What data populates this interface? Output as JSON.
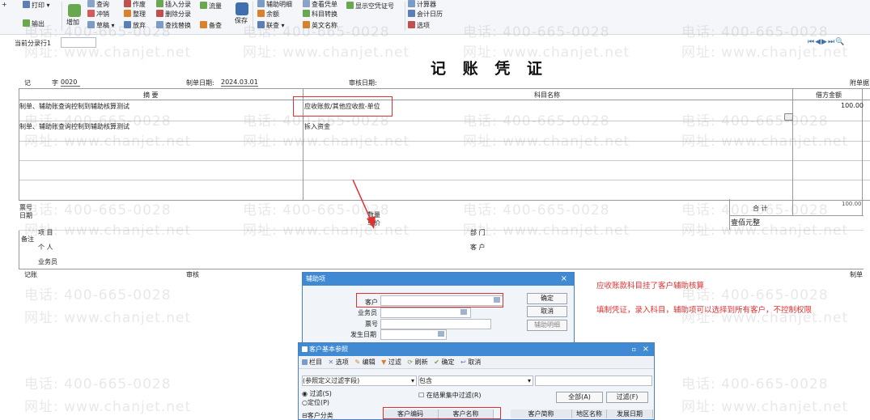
{
  "toolbar": {
    "print": "打印",
    "output": "输出",
    "add": "增加",
    "flush": "冲销",
    "draft": "草稿",
    "tidy": "整理",
    "abandon": "放弃",
    "batch_delete": "删除分录",
    "find_replace": "查找替换",
    "flow": "流量",
    "reference": "备查",
    "save": "保存",
    "balance": "余额",
    "linked_query": "联查",
    "subject_convert": "科目转换",
    "english_name": "英文名称",
    "show_empty_voucher": "显示空凭证号",
    "calculator": "计算器",
    "accounting_calendar": "会计日历",
    "options": "选项"
  },
  "current_entry_label": "当前分录行1",
  "voucher": {
    "title": "记 账 凭 证",
    "type_char": "记",
    "zi": "字",
    "number": "0020",
    "made_date_label": "制单日期:",
    "made_date": "2024.03.01",
    "audit_date_label": "审核日期:",
    "attach_label": "附单据",
    "col_summary": "摘 要",
    "col_subject": "科目名称",
    "col_debit": "借方金额",
    "rows": [
      {
        "summary": "制单、辅助账查询控制到辅助核算测试",
        "subject": "应收账款/其他应收款-单位",
        "debit": "100.00"
      },
      {
        "summary": "制单、辅助账查询控制到辅助核算测试",
        "subject": "拆入资金",
        "debit": ""
      }
    ],
    "ticket_no_label": "票号",
    "date_label": "日期",
    "qty_label": "数量",
    "price_label": "单价",
    "total_label": "合 计",
    "total_amount": "100.00",
    "total_words": "壹佰元整",
    "remark_label": "备注",
    "project_label": "项 目",
    "person_label": "个 人",
    "salesman_label": "业务员",
    "dept_label": "部 门",
    "customer_label": "客 户",
    "bookkeeper_label": "记账",
    "auditor_label": "审核",
    "maker_label": "制单"
  },
  "aux_dialog": {
    "title": "辅助项",
    "customer": "客户",
    "salesman": "业务员",
    "ticket": "票号",
    "date": "发生日期",
    "ok": "确定",
    "cancel": "取消",
    "aux_detail": "辅助明细"
  },
  "customer_ref": {
    "title": "客户基本参照",
    "toolbar": [
      "栏目",
      "选项",
      "编辑",
      "过滤",
      "刷新",
      "确定",
      "取消"
    ],
    "filter_field": "(参照定义过滤字段)",
    "contains": "包含",
    "radio_filter": "过滤(S)",
    "radio_locate": "定位(P)",
    "in_result_filter": "在结果集中过滤(R)",
    "all_btn": "全部(A)",
    "filter_btn": "过滤(F)",
    "tree_root": "客户分类",
    "columns": [
      "客户编码",
      "客户名称",
      "客户简称",
      "地区名称",
      "发展日期"
    ]
  },
  "annotations": {
    "line1": "应收账款科目挂了客户辅助核算",
    "line2": "填制凭证，录入科目，辅助项可以选择到所有客户，不控制权限"
  },
  "watermarks": {
    "phone": "电话: 400-665-0028",
    "site": "网址: www.chanjet.net"
  },
  "colors": {
    "accent": "#3f8ad3",
    "annotation": "#e03030"
  }
}
